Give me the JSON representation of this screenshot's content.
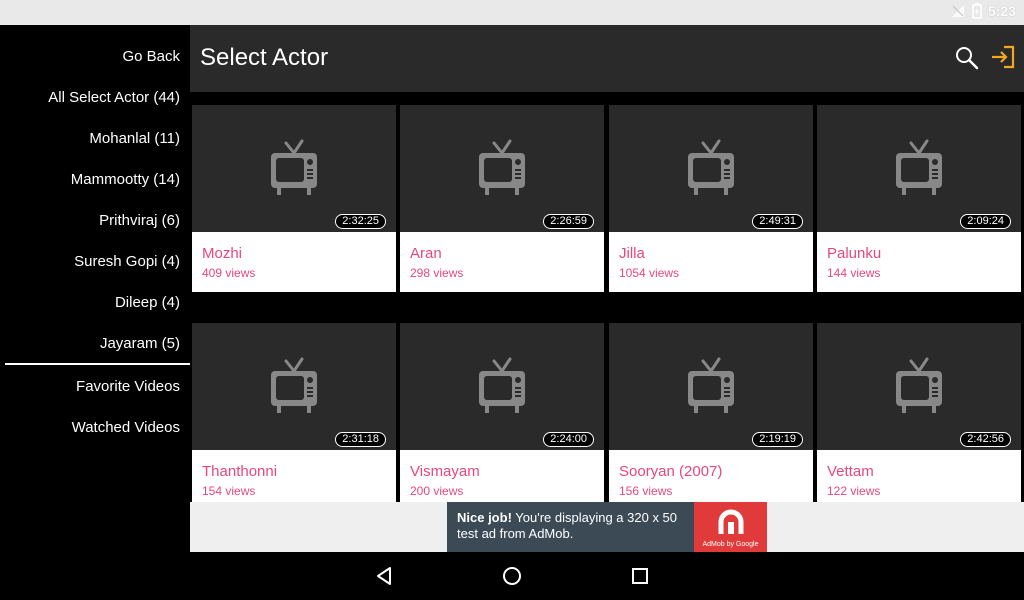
{
  "status": {
    "time": "5:23"
  },
  "sidebar": {
    "items": [
      {
        "label": "Go Back"
      },
      {
        "label": "All Select Actor (44)"
      },
      {
        "label": "Mohanlal (11)"
      },
      {
        "label": "Mammootty (14)"
      },
      {
        "label": "Prithviraj (6)"
      },
      {
        "label": "Suresh Gopi (4)"
      },
      {
        "label": "Dileep (4)"
      },
      {
        "label": "Jayaram (5)"
      }
    ],
    "bottom_items": [
      {
        "label": "Favorite Videos"
      },
      {
        "label": "Watched Videos"
      }
    ]
  },
  "appbar": {
    "title": "Select Actor",
    "search_icon": "search-icon",
    "exit_icon": "exit-icon",
    "accent": "#f5a623"
  },
  "videos": [
    {
      "title": "Mozhi",
      "views": "409 views",
      "duration": "2:32:25"
    },
    {
      "title": "Aran",
      "views": "298 views",
      "duration": "2:26:59"
    },
    {
      "title": "Jilla",
      "views": "1054 views",
      "duration": "2:49:31"
    },
    {
      "title": "Palunku",
      "views": "144 views",
      "duration": "2:09:24"
    },
    {
      "title": "Thanthonni",
      "views": "154 views",
      "duration": "2:31:18"
    },
    {
      "title": "Vismayam",
      "views": "200 views",
      "duration": "2:24:00"
    },
    {
      "title": "Sooryan (2007)",
      "views": "156 views",
      "duration": "2:19:19"
    },
    {
      "title": "Vettam",
      "views": "122 views",
      "duration": "2:42:56"
    }
  ],
  "ad": {
    "headline": "Nice job!",
    "body": " You're displaying a 320 x 50 test ad from AdMob.",
    "brand": "AdMob by Google"
  },
  "colors": {
    "title_pink": "#e8477e",
    "ad_red": "#e03a3a"
  }
}
